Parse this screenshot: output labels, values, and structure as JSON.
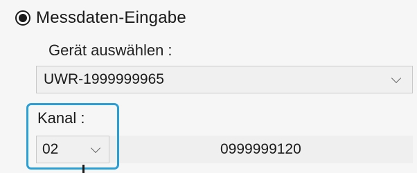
{
  "mode": {
    "label": "Messdaten-Eingabe",
    "selected": true
  },
  "device": {
    "label": "Gerät auswählen :",
    "selected_value": "UWR-1999999965",
    "icon": "chevron-down-icon"
  },
  "channel": {
    "label": "Kanal :",
    "selected_value": "02",
    "icon": "chevron-down-icon",
    "serial_number": "0999999120"
  },
  "colors": {
    "highlight": "#2a9fd6"
  }
}
